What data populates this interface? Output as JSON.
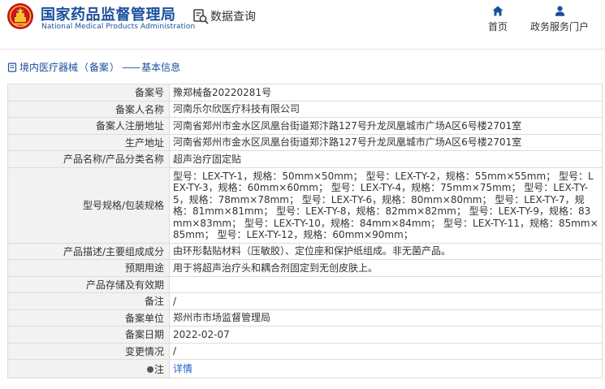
{
  "header": {
    "brand_cn": "国家药品监督管理局",
    "brand_en": "National Medical Products Administration",
    "data_query": "数据查询",
    "nav": {
      "home": "首页",
      "gov_portal": "政务服务门户"
    },
    "colors": {
      "brand": "#1a4f9c",
      "logo_red": "#c8161d",
      "logo_gold": "#f4c430"
    }
  },
  "breadcrumb": {
    "category": "境内医疗器械",
    "sub": "备案",
    "section": "基本信息"
  },
  "record": [
    {
      "label": "备案号",
      "value": "豫郑械备20220281号"
    },
    {
      "label": "备案人名称",
      "value": "河南乐尔欣医疗科技有限公司"
    },
    {
      "label": "备案人注册地址",
      "value": "河南省郑州市金水区凤凰台街道郑汴路127号升龙凤凰城市广场A区6号楼2701室"
    },
    {
      "label": "生产地址",
      "value": "河南省郑州市金水区凤凰台街道郑汴路127号升龙凤凰城市广场A区6号楼2701室"
    },
    {
      "label": "产品名称/产品分类名称",
      "value": "超声治疗固定贴"
    },
    {
      "label": "型号规格/包装规格",
      "value": "型号：LEX-TY-1，规格：50mm×50mm； 型号：LEX-TY-2，规格：55mm×55mm； 型号：LEX-TY-3，规格：60mm×60mm； 型号：LEX-TY-4，规格：75mm×75mm； 型号：LEX-TY-5，规格：78mm×78mm； 型号：LEX-TY-6，规格：80mm×80mm； 型号：LEX-TY-7，规格：81mm×81mm； 型号：LEX-TY-8，规格：82mm×82mm； 型号：LEX-TY-9，规格：83mm×83mm； 型号：LEX-TY-10，规格：84mm×84mm； 型号：LEX-TY-11，规格：85mm×85mm； 型号：LEX-TY-12，规格：60mm×90mm；"
    },
    {
      "label": "产品描述/主要组成成分",
      "value": "由环形黏贴材料（压敏胶）、定位座和保护纸组成。非无菌产品。"
    },
    {
      "label": "预期用途",
      "value": "用于将超声治疗头和耦合剂固定到无创皮肤上。"
    },
    {
      "label": "产品存储及有效期",
      "value": ""
    },
    {
      "label": "备注",
      "value": "/"
    },
    {
      "label": "备案单位",
      "value": "郑州市市场监督管理局"
    },
    {
      "label": "备案日期",
      "value": "2022-02-07"
    },
    {
      "label": "变更情况",
      "value": "/"
    },
    {
      "label": "注",
      "value": "详情"
    }
  ]
}
